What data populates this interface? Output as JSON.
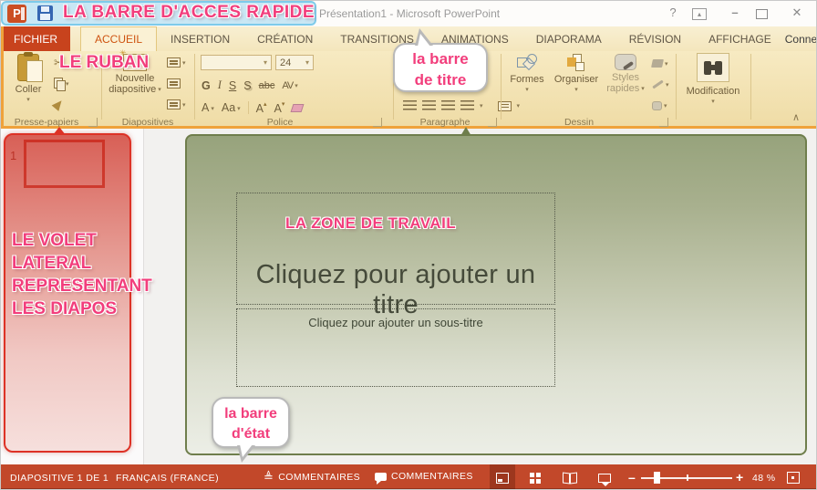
{
  "annotations": {
    "qat_label": "LA BARRE D'ACCES RAPIDE",
    "ribbon_label": "LE RUBAN",
    "title_bubble_line1": "la barre",
    "title_bubble_line2": "de titre",
    "work_area_label": "LA ZONE DE TRAVAIL",
    "sidebar_lines": [
      "LE VOLET",
      "LATERAL",
      "REPRESENTANT",
      "LES DIAPOS"
    ],
    "status_bubble_line1": "la barre",
    "status_bubble_line2": "d'état",
    "pink_accent": "#f23e7c",
    "qat_highlight_color": "#7ecbea",
    "sidebar_highlight_color": "#dd3226",
    "workarea_highlight_color": "#6f7e4c",
    "ribbon_highlight_border": "#efa23b"
  },
  "title_bar": {
    "title": "Présentation1 - Microsoft PowerPoint"
  },
  "icons": {
    "help": "?",
    "minimize": "–",
    "close": "✕",
    "scissors": "✂",
    "undo": "↶",
    "collapse_ribbon": "∧",
    "launcher": "↘",
    "notes": "≜",
    "sparkle": "✳"
  },
  "tab_bar": {
    "tabs": [
      "FICHIER",
      "ACCUEIL",
      "INSERTION",
      "CRÉATION",
      "TRANSITIONS",
      "ANIMATIONS",
      "DIAPORAMA",
      "RÉVISION",
      "AFFICHAGE"
    ],
    "active_tab": "ACCUEIL",
    "account": "Connexion"
  },
  "ribbon": {
    "paste": "Coller",
    "new_slide_line1": "Nouvelle",
    "new_slide_line2": "diapositive",
    "font_size": "24",
    "fmt": {
      "bold": "G",
      "italic": "I",
      "underline": "S",
      "shadow": "S",
      "strikethrough": "abc",
      "char_spacing": "AV",
      "text_shadow": "A",
      "change_case": "Aa",
      "grow_font": "A",
      "shrink_font": "A"
    },
    "shapes": "Formes",
    "arrange": "Organiser",
    "quick_styles_line1": "Styles",
    "quick_styles_line2": "rapides",
    "editing": "Modification",
    "groups": {
      "clipboard": "Presse-papiers",
      "slides": "Diapositives",
      "font": "Police",
      "paragraph": "Paragraphe",
      "drawing": "Dessin"
    }
  },
  "slide": {
    "number": "1",
    "title_placeholder": "Cliquez pour ajouter un titre",
    "subtitle_placeholder": "Cliquez pour ajouter un sous-titre"
  },
  "status_bar": {
    "slide_info": "DIAPOSITIVE 1 DE 1",
    "language": "FRANÇAIS (FRANCE)",
    "notes": "COMMENTAIRES",
    "comments": "COMMENTAIRES",
    "zoom_out": "–",
    "zoom_in": "+",
    "zoom": "48 %"
  }
}
